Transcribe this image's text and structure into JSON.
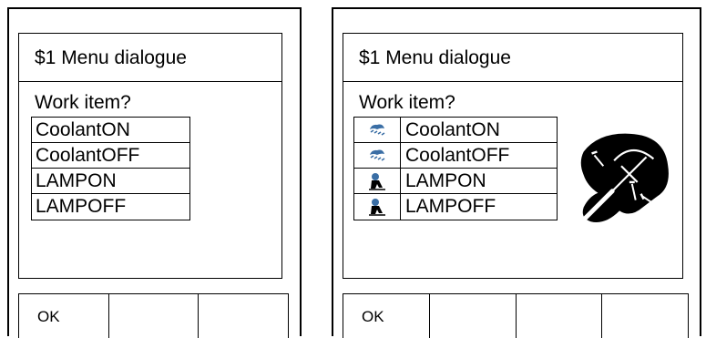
{
  "left_panel": {
    "title": "$1 Menu dialogue",
    "prompt": "Work item?",
    "items": [
      {
        "label": "CoolantON"
      },
      {
        "label": "CoolantOFF"
      },
      {
        "label": "LAMPON"
      },
      {
        "label": "LAMPOFF"
      }
    ],
    "softkeys": [
      "OK",
      "",
      ""
    ]
  },
  "right_panel": {
    "title": "$1 Menu dialogue",
    "prompt": "Work item?",
    "items": [
      {
        "label": "CoolantON",
        "icon": "coolant-icon"
      },
      {
        "label": "CoolantOFF",
        "icon": "coolant-icon"
      },
      {
        "label": "LAMPON",
        "icon": "lamp-worker-icon"
      },
      {
        "label": "LAMPOFF",
        "icon": "lamp-worker-icon"
      }
    ],
    "emblem_icon": "tools-icon",
    "softkeys": [
      "OK",
      "",
      "",
      ""
    ]
  },
  "colors": {
    "line": "#000000",
    "icon_blue": "#3a6ea5"
  }
}
